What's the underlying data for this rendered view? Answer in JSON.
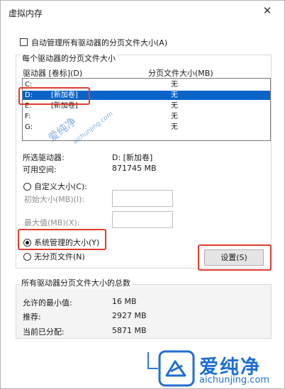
{
  "window": {
    "title": "虚拟内存",
    "close_glyph": "✕"
  },
  "auto_manage": {
    "label": "自动管理所有驱动器的分页文件大小(A)",
    "checked": false
  },
  "per_drive": {
    "group_title": "每个驱动器的分页文件大小",
    "col_drive": "驱动器 [卷标](D)",
    "col_size": "分页文件大小(MB)",
    "rows": [
      {
        "drive": "C:",
        "label": "",
        "size": "无"
      },
      {
        "drive": "D:",
        "label": "[新加卷]",
        "size": "无"
      },
      {
        "drive": "E:",
        "label": "[新加卷]",
        "size": "无"
      },
      {
        "drive": "F:",
        "label": "",
        "size": "无"
      },
      {
        "drive": "G:",
        "label": "",
        "size": "无"
      }
    ],
    "selected_index": 1
  },
  "selected_drive": {
    "label": "所选驱动器:",
    "value": "D: [新加卷]"
  },
  "free_space": {
    "label": "可用空间:",
    "value": "871745 MB"
  },
  "options": {
    "custom": "自定义大小(C):",
    "initial_label": "初始大小(MB)(I):",
    "max_label": "最大值(MB)(X):",
    "system_managed": "系统管理的大小(Y)",
    "no_paging": "无分页文件(N)",
    "selected": "system_managed"
  },
  "set_button": "设置(S)",
  "totals": {
    "group_title": "所有驱动器分页文件大小的总数",
    "min_label": "允许的最小值:",
    "min_value": "16 MB",
    "recommended_label": "推荐:",
    "recommended_value": "2927 MB",
    "allocated_label": "当前已分配:",
    "allocated_value": "5871 MB"
  },
  "watermark": {
    "center_text": "爱纯净",
    "center_url": "aichunjing.com",
    "brand": "爱纯净",
    "brand_url": "aichunjing.com"
  },
  "colors": {
    "selection": "#0a64c8",
    "highlight": "#e23a2e",
    "watermark": "#1f6fd1"
  }
}
